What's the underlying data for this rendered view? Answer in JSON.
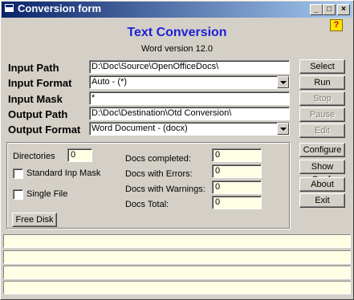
{
  "window": {
    "title": "Conversion form",
    "buttons": [
      "_",
      "□",
      "×"
    ]
  },
  "header": {
    "title": "Text Conversion",
    "subtitle": "Word version 12.0",
    "help": "?"
  },
  "form": {
    "input_path": {
      "label": "Input Path",
      "value": "D:\\Doc\\Source\\OpenOfficeDocs\\"
    },
    "input_format": {
      "label": "Input Format",
      "value": "Auto - (*)"
    },
    "input_mask": {
      "label": "Input Mask",
      "value": "*"
    },
    "output_path": {
      "label": "Output Path",
      "value": "D:\\Doc\\Destination\\Otd Conversion\\"
    },
    "output_format": {
      "label": "Output Format",
      "value": "Word Document - (docx)"
    }
  },
  "actions": {
    "select": "Select",
    "run": "Run",
    "stop": "Stop",
    "pause": "Pause",
    "edit": "Edit",
    "configure": "Configure",
    "show_conf": "Show Conf.",
    "about": "About",
    "exit": "Exit"
  },
  "options": {
    "directories_label": "Directories",
    "directories_value": "0",
    "standard_mask": "Standard Inp Mask",
    "single_file": "Single File",
    "free_disk": "Free Disk"
  },
  "stats": {
    "completed_label": "Docs completed:",
    "completed": "0",
    "errors_label": "Docs with Errors:",
    "errors": "0",
    "warnings_label": "Docs with Warnings:",
    "warnings": "0",
    "total_label": "Docs Total:",
    "total": "0"
  }
}
